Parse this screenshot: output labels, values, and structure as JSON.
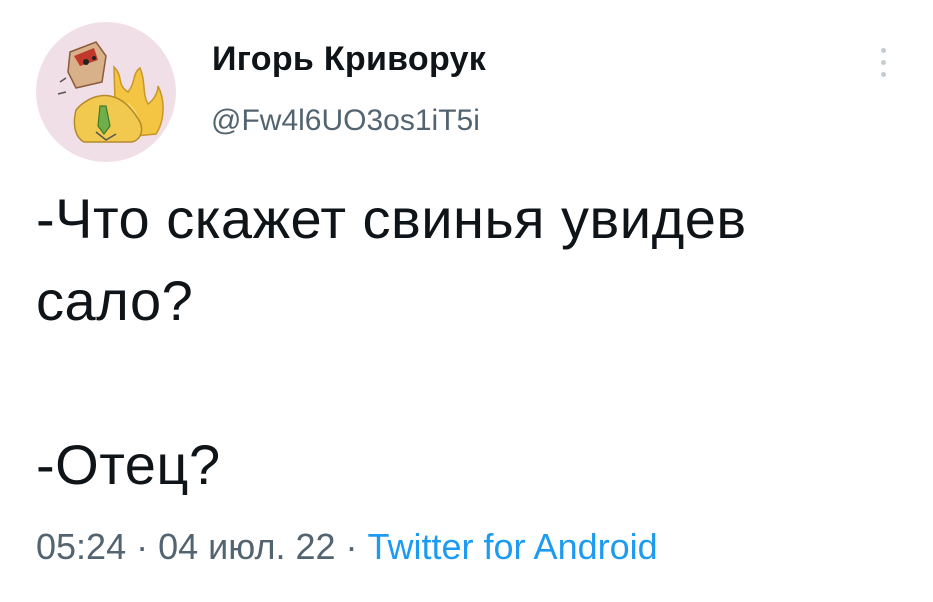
{
  "user": {
    "display_name": "Игорь Криворук",
    "handle": "@Fw4l6UO3os1iT5i"
  },
  "tweet": {
    "line1": "-Что скажет свинья увидев\nсало?",
    "line2": "-Отец?"
  },
  "meta": {
    "time": "05:24",
    "separator": "·",
    "date": "04 июл. 22",
    "source": "Twitter for Android"
  },
  "colors": {
    "text": "#0f1419",
    "secondary": "#536471",
    "link": "#1d9bf0",
    "avatar_bg": "#f1dfe7"
  },
  "icons": {
    "more": "vertical-ellipsis-icon"
  }
}
